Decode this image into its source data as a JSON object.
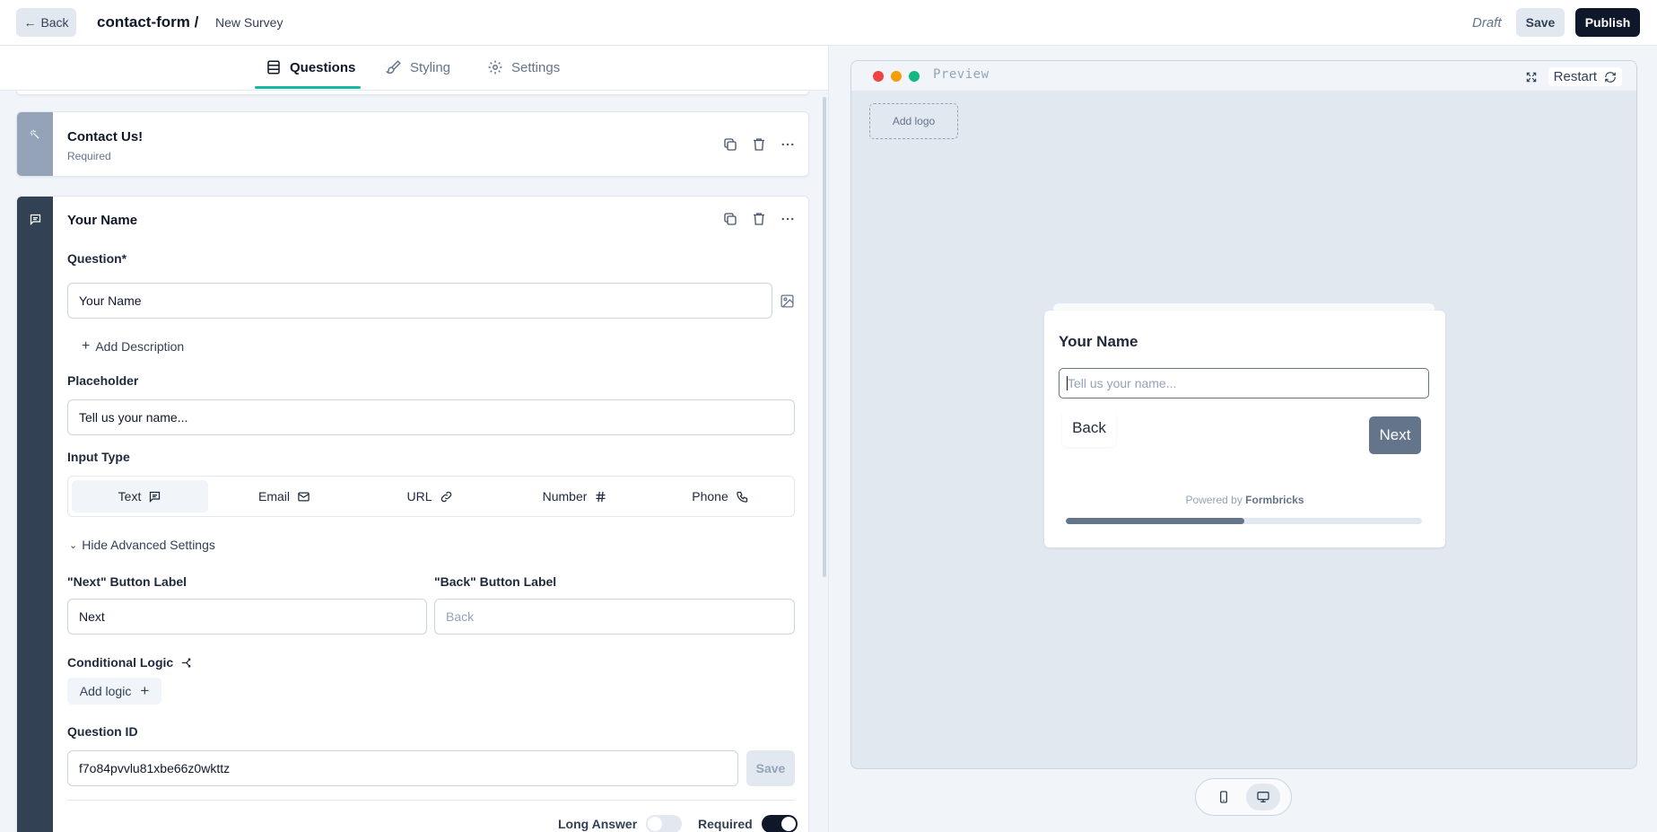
{
  "topbar": {
    "back_label": "Back",
    "project": "contact-form /",
    "survey_name": "New Survey",
    "status": "Draft",
    "save_label": "Save",
    "publish_label": "Publish"
  },
  "tabs": [
    {
      "label": "Questions",
      "icon": "rows-icon"
    },
    {
      "label": "Styling",
      "icon": "paintbrush-icon"
    },
    {
      "label": "Settings",
      "icon": "gear-icon"
    }
  ],
  "cards": {
    "welcome": {
      "title": "Contact Us!",
      "subtitle": "Required"
    },
    "question": {
      "title": "Your Name",
      "question_label": "Question*",
      "question_value": "Your Name",
      "add_description": "Add Description",
      "placeholder_label": "Placeholder",
      "placeholder_value": "Tell us your name...",
      "input_type_label": "Input Type",
      "input_types": [
        {
          "label": "Text",
          "icon": "message-icon",
          "selected": true
        },
        {
          "label": "Email",
          "icon": "mail-icon",
          "selected": false
        },
        {
          "label": "URL",
          "icon": "link-icon",
          "selected": false
        },
        {
          "label": "Number",
          "icon": "hash-icon",
          "selected": false
        },
        {
          "label": "Phone",
          "icon": "phone-icon",
          "selected": false
        }
      ],
      "advanced_toggle": "Hide Advanced Settings",
      "next_button_label": "\"Next\" Button Label",
      "next_button_value": "Next",
      "back_button_label": "\"Back\" Button Label",
      "back_button_placeholder": "Back",
      "conditional_logic_label": "Conditional Logic",
      "add_logic_label": "Add logic",
      "question_id_label": "Question ID",
      "question_id_value": "f7o84pvvlu81xbe66z0wkttz",
      "question_id_save": "Save",
      "long_answer_label": "Long Answer",
      "long_answer_on": false,
      "required_label": "Required",
      "required_on": true
    }
  },
  "preview": {
    "title": "Preview",
    "restart_label": "Restart",
    "add_logo": "Add logo",
    "question": "Your Name",
    "input_placeholder": "Tell us your name...",
    "back_label": "Back",
    "next_label": "Next",
    "powered_by_prefix": "Powered by",
    "powered_by_brand": "Formbricks",
    "progress": 0.5
  },
  "colors": {
    "accent_tab": "#14b8a6",
    "publish_bg": "#0f172a",
    "brand_slate": "#64748b"
  }
}
